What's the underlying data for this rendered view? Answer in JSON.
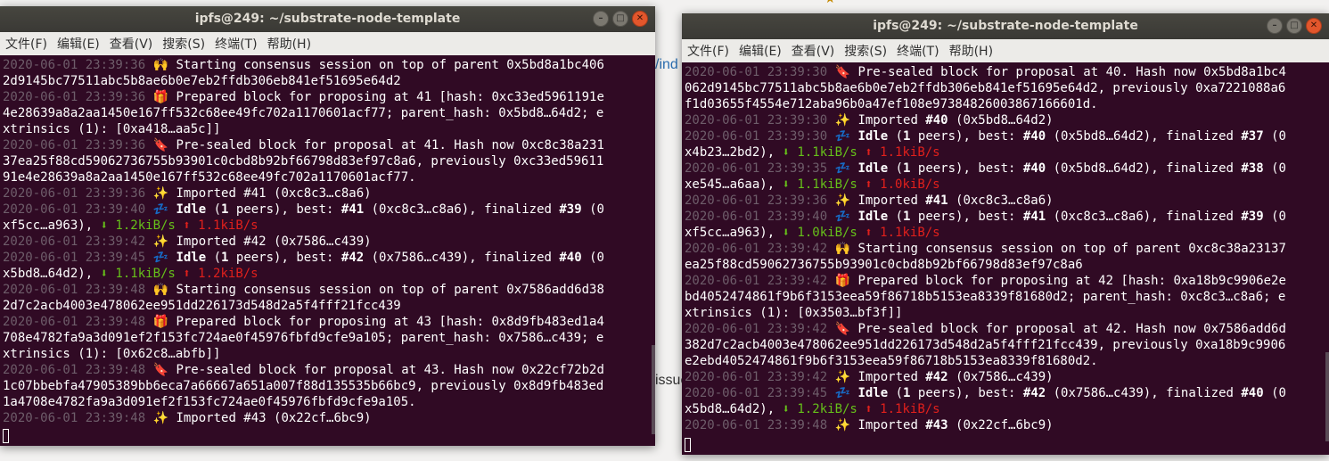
{
  "background": {
    "link_fragment": "/ind",
    "issue_fragment": "issue",
    "top_mark": "★"
  },
  "terminals": [
    {
      "title": "ipfs@249: ~/substrate-node-template",
      "menu": [
        "文件(F)",
        "编辑(E)",
        "查看(V)",
        "搜索(S)",
        "终端(T)",
        "帮助(H)"
      ],
      "lines": [
        [
          {
            "t": "ts",
            "v": "2020-06-01 23:39:36 "
          },
          {
            "t": "n",
            "v": "🙌 Starting consensus session on top of parent 0x5bd8a1bc406"
          }
        ],
        [
          {
            "t": "n",
            "v": "2d9145bc77511abc5b8ae6b0e7eb2ffdb306eb841ef51695e64d2"
          }
        ],
        [
          {
            "t": "ts",
            "v": "2020-06-01 23:39:36 "
          },
          {
            "t": "n",
            "v": "🎁 Prepared block for proposing at 41 [hash: 0xc33ed5961191e"
          }
        ],
        [
          {
            "t": "n",
            "v": "4e28639a8a2aa1450e167ff532c68ee49fc702a1170601acf77; parent_hash: 0x5bd8…64d2; e"
          }
        ],
        [
          {
            "t": "n",
            "v": "xtrinsics (1): [0xa418…aa5c]]"
          }
        ],
        [
          {
            "t": "ts",
            "v": "2020-06-01 23:39:36 "
          },
          {
            "t": "n",
            "v": "🔖 Pre-sealed block for proposal at 41. Hash now 0xc8c38a231"
          }
        ],
        [
          {
            "t": "n",
            "v": "37ea25f88cd59062736755b93901c0cbd8b92bf66798d83ef97c8a6, previously 0xc33ed59611"
          }
        ],
        [
          {
            "t": "n",
            "v": "91e4e28639a8a2aa1450e167ff532c68ee49fc702a1170601acf77."
          }
        ],
        [
          {
            "t": "ts",
            "v": "2020-06-01 23:39:36 "
          },
          {
            "t": "n",
            "v": "✨ Imported #41 (0xc8c3…c8a6)"
          }
        ],
        [
          {
            "t": "ts",
            "v": "2020-06-01 23:39:40 "
          },
          {
            "t": "n",
            "v": "💤 "
          },
          {
            "t": "b",
            "v": "Idle"
          },
          {
            "t": "n",
            "v": " ("
          },
          {
            "t": "b",
            "v": "1"
          },
          {
            "t": "n",
            "v": " peers), best: "
          },
          {
            "t": "b",
            "v": "#41"
          },
          {
            "t": "n",
            "v": " (0xc8c3…c8a6), finalized "
          },
          {
            "t": "b",
            "v": "#39"
          },
          {
            "t": "n",
            "v": " (0"
          }
        ],
        [
          {
            "t": "n",
            "v": "xf5cc…a963), "
          },
          {
            "t": "up",
            "v": "⬇ 1.2kiB/s"
          },
          {
            "t": "n",
            "v": " "
          },
          {
            "t": "down",
            "v": "⬆ 1.1kiB/s"
          }
        ],
        [
          {
            "t": "ts",
            "v": "2020-06-01 23:39:42 "
          },
          {
            "t": "n",
            "v": "✨ Imported #42 (0x7586…c439)"
          }
        ],
        [
          {
            "t": "ts",
            "v": "2020-06-01 23:39:45 "
          },
          {
            "t": "n",
            "v": "💤 "
          },
          {
            "t": "b",
            "v": "Idle"
          },
          {
            "t": "n",
            "v": " ("
          },
          {
            "t": "b",
            "v": "1"
          },
          {
            "t": "n",
            "v": " peers), best: "
          },
          {
            "t": "b",
            "v": "#42"
          },
          {
            "t": "n",
            "v": " (0x7586…c439), finalized "
          },
          {
            "t": "b",
            "v": "#40"
          },
          {
            "t": "n",
            "v": " (0"
          }
        ],
        [
          {
            "t": "n",
            "v": "x5bd8…64d2), "
          },
          {
            "t": "up",
            "v": "⬇ 1.1kiB/s"
          },
          {
            "t": "n",
            "v": " "
          },
          {
            "t": "down",
            "v": "⬆ 1.2kiB/s"
          }
        ],
        [
          {
            "t": "ts",
            "v": "2020-06-01 23:39:48 "
          },
          {
            "t": "n",
            "v": "🙌 Starting consensus session on top of parent 0x7586add6d38"
          }
        ],
        [
          {
            "t": "n",
            "v": "2d7c2acb4003e478062ee951dd226173d548d2a5f4fff21fcc439"
          }
        ],
        [
          {
            "t": "ts",
            "v": "2020-06-01 23:39:48 "
          },
          {
            "t": "n",
            "v": "🎁 Prepared block for proposing at 43 [hash: 0x8d9fb483ed1a4"
          }
        ],
        [
          {
            "t": "n",
            "v": "708e4782fa9a3d091ef2f153fc724ae0f45976fbfd9cfe9a105; parent_hash: 0x7586…c439; e"
          }
        ],
        [
          {
            "t": "n",
            "v": "xtrinsics (1): [0x62c8…abfb]]"
          }
        ],
        [
          {
            "t": "ts",
            "v": "2020-06-01 23:39:48 "
          },
          {
            "t": "n",
            "v": "🔖 Pre-sealed block for proposal at 43. Hash now 0x22cf72b2d"
          }
        ],
        [
          {
            "t": "n",
            "v": "1c07bbebfa47905389bb6eca7a66667a651a007f88d135535b66bc9, previously 0x8d9fb483ed"
          }
        ],
        [
          {
            "t": "n",
            "v": "1a4708e4782fa9a3d091ef2f153fc724ae0f45976fbfd9cfe9a105."
          }
        ],
        [
          {
            "t": "ts",
            "v": "2020-06-01 23:39:48 "
          },
          {
            "t": "n",
            "v": "✨ Imported #43 (0x22cf…6bc9)"
          }
        ]
      ]
    },
    {
      "title": "ipfs@249: ~/substrate-node-template",
      "menu": [
        "文件(F)",
        "编辑(E)",
        "查看(V)",
        "搜索(S)",
        "终端(T)",
        "帮助(H)"
      ],
      "lines": [
        [
          {
            "t": "ts",
            "v": "2020-06-01 23:39:30 "
          },
          {
            "t": "n",
            "v": "🔖 Pre-sealed block for proposal at 40. Hash now 0x5bd8a1bc4"
          }
        ],
        [
          {
            "t": "n",
            "v": "062d9145bc77511abc5b8ae6b0e7eb2ffdb306eb841ef51695e64d2, previously 0xa7221088a6"
          }
        ],
        [
          {
            "t": "n",
            "v": "f1d03655f4554e712aba96b0a47ef108e97384826003867166601d."
          }
        ],
        [
          {
            "t": "ts",
            "v": "2020-06-01 23:39:30 "
          },
          {
            "t": "n",
            "v": "✨ Imported "
          },
          {
            "t": "b",
            "v": "#40"
          },
          {
            "t": "n",
            "v": " (0x5bd8…64d2)"
          }
        ],
        [
          {
            "t": "ts",
            "v": "2020-06-01 23:39:30 "
          },
          {
            "t": "n",
            "v": "💤 "
          },
          {
            "t": "b",
            "v": "Idle"
          },
          {
            "t": "n",
            "v": " ("
          },
          {
            "t": "b",
            "v": "1"
          },
          {
            "t": "n",
            "v": " peers), best: "
          },
          {
            "t": "b",
            "v": "#40"
          },
          {
            "t": "n",
            "v": " (0x5bd8…64d2), finalized "
          },
          {
            "t": "b",
            "v": "#37"
          },
          {
            "t": "n",
            "v": " (0"
          }
        ],
        [
          {
            "t": "n",
            "v": "x4b23…2bd2), "
          },
          {
            "t": "up",
            "v": "⬇ 1.1kiB/s"
          },
          {
            "t": "n",
            "v": " "
          },
          {
            "t": "down",
            "v": "⬆ 1.1kiB/s"
          }
        ],
        [
          {
            "t": "ts",
            "v": "2020-06-01 23:39:35 "
          },
          {
            "t": "n",
            "v": "💤 "
          },
          {
            "t": "b",
            "v": "Idle"
          },
          {
            "t": "n",
            "v": " ("
          },
          {
            "t": "b",
            "v": "1"
          },
          {
            "t": "n",
            "v": " peers), best: "
          },
          {
            "t": "b",
            "v": "#40"
          },
          {
            "t": "n",
            "v": " (0x5bd8…64d2), finalized "
          },
          {
            "t": "b",
            "v": "#38"
          },
          {
            "t": "n",
            "v": " (0"
          }
        ],
        [
          {
            "t": "n",
            "v": "xe545…a6aa), "
          },
          {
            "t": "up",
            "v": "⬇ 1.1kiB/s"
          },
          {
            "t": "n",
            "v": " "
          },
          {
            "t": "down",
            "v": "⬆ 1.0kiB/s"
          }
        ],
        [
          {
            "t": "ts",
            "v": "2020-06-01 23:39:36 "
          },
          {
            "t": "n",
            "v": "✨ Imported "
          },
          {
            "t": "b",
            "v": "#41"
          },
          {
            "t": "n",
            "v": " (0xc8c3…c8a6)"
          }
        ],
        [
          {
            "t": "ts",
            "v": "2020-06-01 23:39:40 "
          },
          {
            "t": "n",
            "v": "💤 "
          },
          {
            "t": "b",
            "v": "Idle"
          },
          {
            "t": "n",
            "v": " ("
          },
          {
            "t": "b",
            "v": "1"
          },
          {
            "t": "n",
            "v": " peers), best: "
          },
          {
            "t": "b",
            "v": "#41"
          },
          {
            "t": "n",
            "v": " (0xc8c3…c8a6), finalized "
          },
          {
            "t": "b",
            "v": "#39"
          },
          {
            "t": "n",
            "v": " (0"
          }
        ],
        [
          {
            "t": "n",
            "v": "xf5cc…a963), "
          },
          {
            "t": "up",
            "v": "⬇ 1.0kiB/s"
          },
          {
            "t": "n",
            "v": " "
          },
          {
            "t": "down",
            "v": "⬆ 1.1kiB/s"
          }
        ],
        [
          {
            "t": "ts",
            "v": "2020-06-01 23:39:42 "
          },
          {
            "t": "n",
            "v": "🙌 Starting consensus session on top of parent 0xc8c38a23137"
          }
        ],
        [
          {
            "t": "n",
            "v": "ea25f88cd59062736755b93901c0cbd8b92bf66798d83ef97c8a6"
          }
        ],
        [
          {
            "t": "ts",
            "v": "2020-06-01 23:39:42 "
          },
          {
            "t": "n",
            "v": "🎁 Prepared block for proposing at 42 [hash: 0xa18b9c9906e2e"
          }
        ],
        [
          {
            "t": "n",
            "v": "bd4052474861f9b6f3153eea59f86718b5153ea8339f81680d2; parent_hash: 0xc8c3…c8a6; e"
          }
        ],
        [
          {
            "t": "n",
            "v": "xtrinsics (1): [0x3503…bf3f]]"
          }
        ],
        [
          {
            "t": "ts",
            "v": "2020-06-01 23:39:42 "
          },
          {
            "t": "n",
            "v": "🔖 Pre-sealed block for proposal at 42. Hash now 0x7586add6d"
          }
        ],
        [
          {
            "t": "n",
            "v": "382d7c2acb4003e478062ee951dd226173d548d2a5f4fff21fcc439, previously 0xa18b9c9906"
          }
        ],
        [
          {
            "t": "n",
            "v": "e2ebd4052474861f9b6f3153eea59f86718b5153ea8339f81680d2."
          }
        ],
        [
          {
            "t": "ts",
            "v": "2020-06-01 23:39:42 "
          },
          {
            "t": "n",
            "v": "✨ Imported "
          },
          {
            "t": "b",
            "v": "#42"
          },
          {
            "t": "n",
            "v": " (0x7586…c439)"
          }
        ],
        [
          {
            "t": "ts",
            "v": "2020-06-01 23:39:45 "
          },
          {
            "t": "n",
            "v": "💤 "
          },
          {
            "t": "b",
            "v": "Idle"
          },
          {
            "t": "n",
            "v": " ("
          },
          {
            "t": "b",
            "v": "1"
          },
          {
            "t": "n",
            "v": " peers), best: "
          },
          {
            "t": "b",
            "v": "#42"
          },
          {
            "t": "n",
            "v": " (0x7586…c439), finalized "
          },
          {
            "t": "b",
            "v": "#40"
          },
          {
            "t": "n",
            "v": " (0"
          }
        ],
        [
          {
            "t": "n",
            "v": "x5bd8…64d2), "
          },
          {
            "t": "up",
            "v": "⬇ 1.2kiB/s"
          },
          {
            "t": "n",
            "v": " "
          },
          {
            "t": "down",
            "v": "⬆ 1.1kiB/s"
          }
        ],
        [
          {
            "t": "ts",
            "v": "2020-06-01 23:39:48 "
          },
          {
            "t": "n",
            "v": "✨ Imported "
          },
          {
            "t": "b",
            "v": "#43"
          },
          {
            "t": "n",
            "v": " (0x22cf…6bc9)"
          }
        ]
      ]
    }
  ],
  "window_buttons": {
    "minimize": "–",
    "maximize": "□",
    "close": "✕"
  },
  "colors": {
    "terminal_bg": "#300a24",
    "timestamp": "#6e5d6a",
    "download": "#66c01a",
    "upload": "#e0201c",
    "titlebar": "#3a3935"
  }
}
